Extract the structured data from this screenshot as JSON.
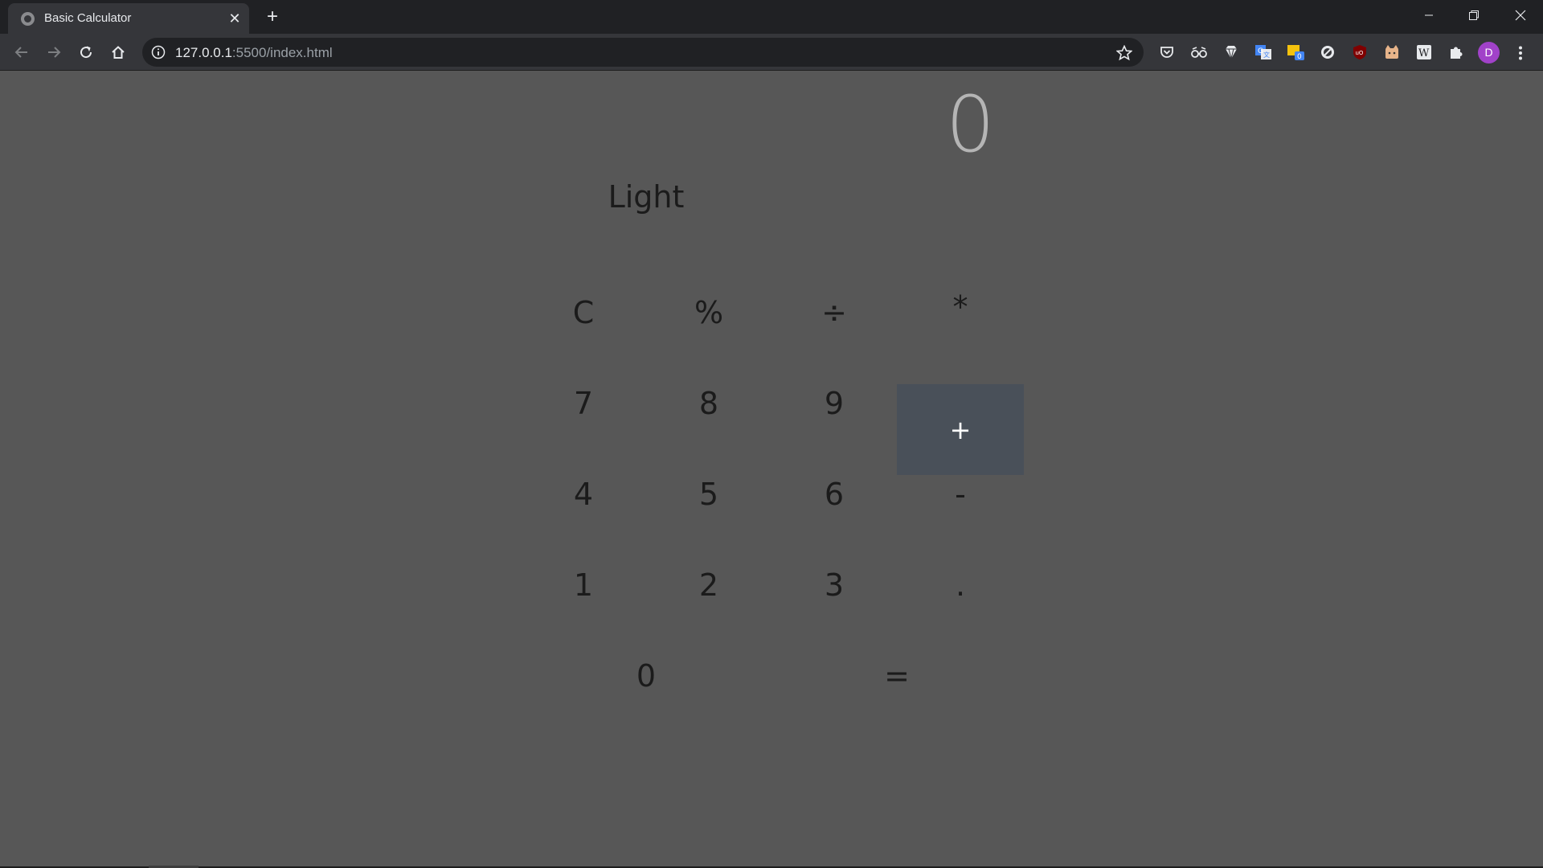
{
  "browser": {
    "tab_title": "Basic Calculator",
    "close_glyph": "✕",
    "new_tab_glyph": "+",
    "url_host": "127.0.0.1",
    "url_rest": ":5500/index.html",
    "avatar_letter": "D",
    "extensions": [
      "pocket-icon",
      "glasses-icon",
      "diamond-icon",
      "translate-icon",
      "notes-icon",
      "block-icon",
      "ublock-icon",
      "cat-icon",
      "wikipedia-icon",
      "puzzle-icon"
    ],
    "notes_badge": "0",
    "ublock_label": "uO",
    "wiki_label": "W"
  },
  "calculator": {
    "display": "0",
    "theme_toggle": "Light",
    "keys": {
      "clear": "C",
      "percent": "%",
      "divide": "÷",
      "multiply": "*",
      "seven": "7",
      "eight": "8",
      "nine": "9",
      "add": "+",
      "four": "4",
      "five": "5",
      "six": "6",
      "subtract": "-",
      "one": "1",
      "two": "2",
      "three": "3",
      "decimal": ".",
      "zero": "0",
      "equals": "="
    },
    "active_key": "add",
    "colors": {
      "page_background": "#575757",
      "active_key_background": "#495059",
      "key_text": "#1b1b1b",
      "display_text": "#b5b5b5"
    }
  }
}
